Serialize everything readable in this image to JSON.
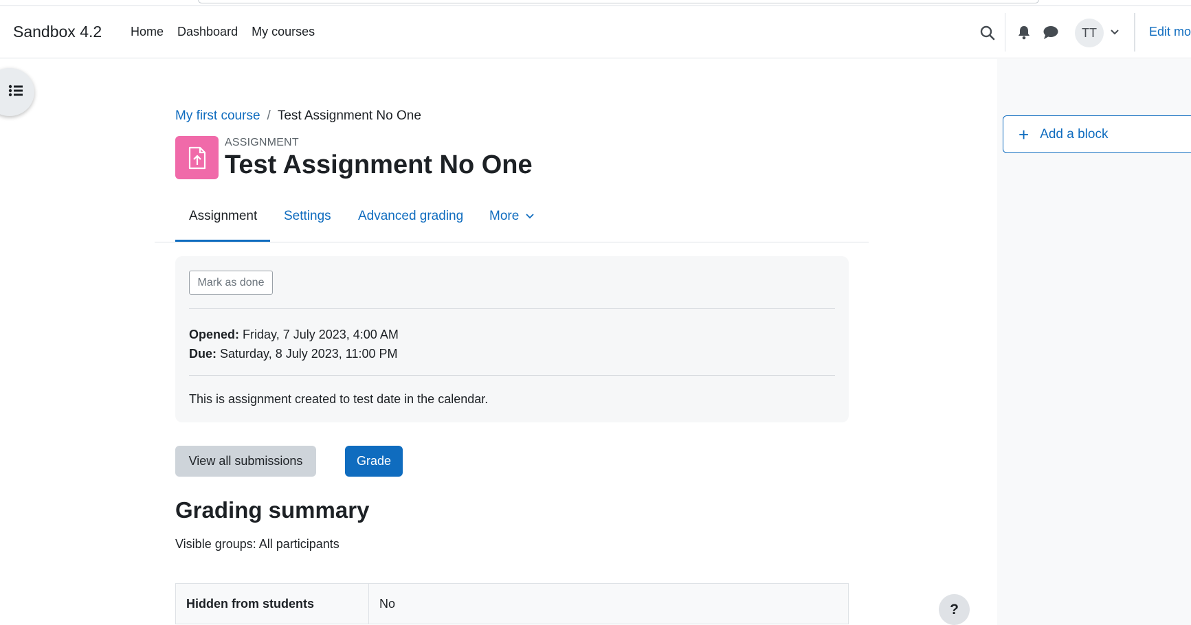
{
  "site": {
    "name": "Sandbox 4.2"
  },
  "primary_nav": {
    "items": [
      "Home",
      "Dashboard",
      "My courses"
    ]
  },
  "user": {
    "initials": "TT"
  },
  "header": {
    "edit_mode_label": "Edit mo"
  },
  "breadcrumb": {
    "course": "My first course",
    "current": "Test Assignment No One"
  },
  "activity": {
    "type_label": "ASSIGNMENT",
    "title": "Test Assignment No One",
    "icon_color": "#f06aa9"
  },
  "secondary_nav": {
    "tabs": [
      {
        "label": "Assignment",
        "active": true
      },
      {
        "label": "Settings"
      },
      {
        "label": "Advanced grading"
      },
      {
        "label": "More"
      }
    ]
  },
  "completion": {
    "mark_done_label": "Mark as done"
  },
  "dates": {
    "opened_label": "Opened:",
    "opened_value": "Friday, 7 July 2023, 4:00 AM",
    "due_label": "Due:",
    "due_value": "Saturday, 8 July 2023, 11:00 PM"
  },
  "description": "This is assignment created to test date in the calendar.",
  "actions": {
    "view_all_label": "View all submissions",
    "grade_label": "Grade"
  },
  "grading_summary": {
    "title": "Grading summary",
    "groups_text": "Visible groups: All participants",
    "rows": [
      {
        "label": "Hidden from students",
        "value": "No"
      }
    ]
  },
  "right_drawer": {
    "add_block_label": "Add a block"
  },
  "help": {
    "label": "?"
  },
  "colors": {
    "accent": "#0f6cbf",
    "activity_pink": "#f06aa9"
  }
}
